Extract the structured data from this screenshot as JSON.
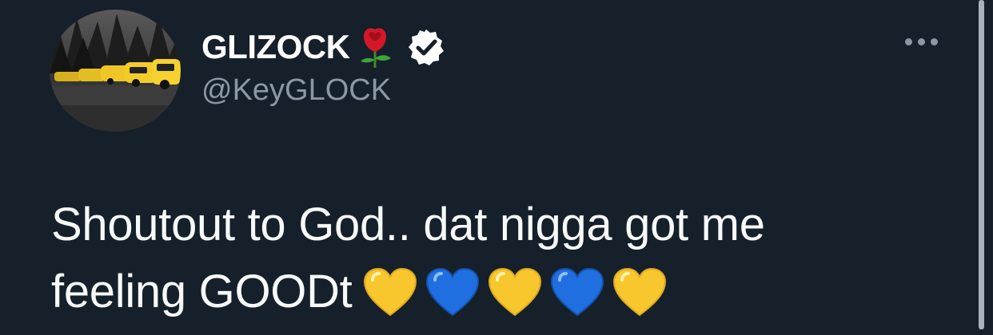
{
  "tweet": {
    "display_name": "GLIZOCK",
    "name_emoji": "rose-emoji",
    "verified": true,
    "handle": "@KeyGLOCK",
    "text_line1": "Shoutout to God.. dat nigga got me",
    "text_line2": "feeling GOODt",
    "hearts": [
      "yellow-heart",
      "blue-heart",
      "yellow-heart",
      "blue-heart",
      "yellow-heart"
    ]
  },
  "icons": {
    "avatar": "avatar-photo",
    "rose": "rose-icon",
    "verified": "verified-badge-icon",
    "more": "more-options-icon"
  },
  "colors": {
    "background": "#15202b",
    "primary_text": "#f7f9f9",
    "secondary_text": "#8b98a5",
    "yellow_heart": "#f7c72d",
    "blue_heart": "#1f6fe0"
  }
}
